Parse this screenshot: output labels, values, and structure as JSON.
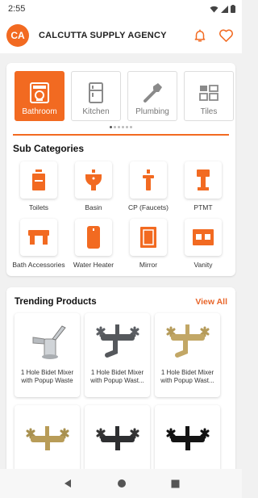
{
  "status": {
    "time": "2:55"
  },
  "header": {
    "avatar_initials": "CA",
    "title": "CALCUTTA SUPPLY AGENCY",
    "icons": [
      "bell-icon",
      "heart-icon"
    ]
  },
  "categories": [
    {
      "label": "Bathroom",
      "icon": "bathroom-icon",
      "active": true
    },
    {
      "label": "Kitchen",
      "icon": "fridge-icon",
      "active": false
    },
    {
      "label": "Plumbing",
      "icon": "wrench-icon",
      "active": false
    },
    {
      "label": "Tiles",
      "icon": "tiles-icon",
      "active": false
    }
  ],
  "sub_categories": {
    "title": "Sub Categories",
    "items": [
      {
        "label": "Toilets",
        "icon": "toilet-icon"
      },
      {
        "label": "Basin",
        "icon": "basin-icon"
      },
      {
        "label": "CP (Faucets)",
        "icon": "faucet-icon"
      },
      {
        "label": "PTMT",
        "icon": "ptmt-icon"
      },
      {
        "label": "Bath Accessories",
        "icon": "towel-rack-icon"
      },
      {
        "label": "Water Heater",
        "icon": "water-heater-icon"
      },
      {
        "label": "Mirror",
        "icon": "mirror-icon"
      },
      {
        "label": "Vanity",
        "icon": "vanity-icon"
      }
    ]
  },
  "trending": {
    "title": "Trending Products",
    "view_all": "View All",
    "products": [
      {
        "name": "1 Hole Bidet Mixer with Popup Waste",
        "finish": "chrome"
      },
      {
        "name": "1 Hole Bidet Mixer with Popup Wast...",
        "finish": "gunmetal"
      },
      {
        "name": "1 Hole Bidet Mixer with Popup Wast...",
        "finish": "gold"
      },
      {
        "name": "",
        "finish": "gold"
      },
      {
        "name": "",
        "finish": "black"
      },
      {
        "name": "",
        "finish": "matte-black"
      }
    ]
  },
  "colors": {
    "accent": "#f26a21",
    "accent_text": "#e8662b"
  }
}
